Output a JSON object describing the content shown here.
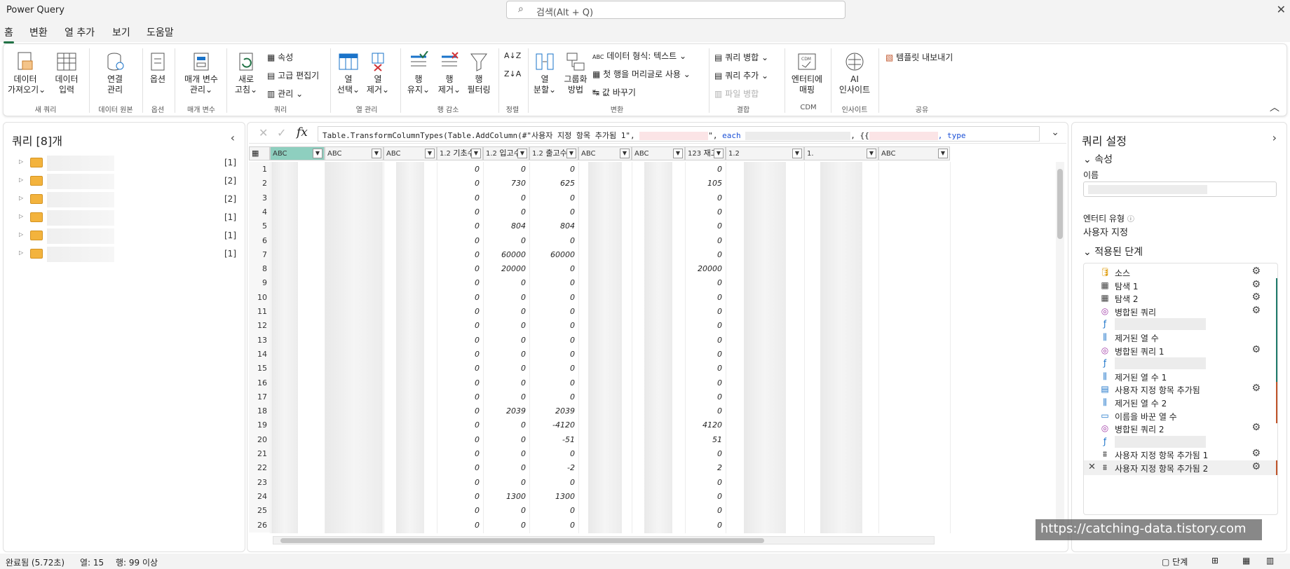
{
  "app": {
    "title": "Power Query"
  },
  "search": {
    "placeholder": "검색(Alt + Q)"
  },
  "tabs": [
    "홈",
    "변환",
    "열 추가",
    "보기",
    "도움말"
  ],
  "ribbon": {
    "get_data": "데이터\n가져오기⌄",
    "enter_data": "데이터\n입력",
    "group_new_query": "새 쿼리",
    "manage_connections": "연결\n관리",
    "group_data_source": "데이터 원본",
    "options": "옵션",
    "group_options": "옵션",
    "manage_params": "매개 변수\n관리⌄",
    "group_params": "매개 변수",
    "refresh": "새로\n고침⌄",
    "properties": "속성",
    "advanced_editor": "고급 편집기",
    "manage": "관리 ⌄",
    "group_query": "쿼리",
    "choose_columns": "열\n선택⌄",
    "remove_columns": "열\n제거⌄",
    "group_manage_columns": "열 관리",
    "keep_rows": "행\n유지⌄",
    "remove_rows": "행\n제거⌄",
    "filter_rows": "행\n필터링",
    "group_reduce_rows": "행 감소",
    "group_sort": "정렬",
    "split_column": "열\n분할⌄",
    "group_by": "그룹화\n방법",
    "data_type": "데이터 형식: 텍스트 ⌄",
    "first_row_header": "첫 행을 머리글로 사용 ⌄",
    "replace_values": "값 바꾸기",
    "group_transform": "변환",
    "merge_queries": "쿼리 병합 ⌄",
    "append_queries": "쿼리 추가 ⌄",
    "combine_files": "파일 병합",
    "group_combine": "결합",
    "map_entities": "엔터티에\n매핑",
    "group_cdm": "CDM",
    "ai_insights": "AI\n인사이트",
    "group_insights": "인사이트",
    "export_template": "템플릿 내보내기",
    "group_share": "공유"
  },
  "queries_panel": {
    "title": "쿼리 [8]개",
    "items": [
      {
        "count": "[1]"
      },
      {
        "count": "[2]"
      },
      {
        "count": "[2]"
      },
      {
        "count": "[1]"
      },
      {
        "count": "[1]"
      },
      {
        "count": "[1]"
      }
    ]
  },
  "formula": {
    "prefix": "Table.TransformColumnTypes(Table.AddColumn(#\"사용자 지정 항목 추가됨 1\",",
    "q1": "\",",
    "each": "each",
    "mid": ", {{",
    "type": ", type"
  },
  "columns": [
    {
      "type": "ABC",
      "label": ""
    },
    {
      "type": "ABC",
      "label": ""
    },
    {
      "type": "ABC",
      "label": ""
    },
    {
      "type": "1.2",
      "label": "기초수"
    },
    {
      "type": "1.2",
      "label": "입고수"
    },
    {
      "type": "1.2",
      "label": "출고수"
    },
    {
      "type": "ABC",
      "label": ""
    },
    {
      "type": "ABC",
      "label": ""
    },
    {
      "type": "123",
      "label": "재고"
    },
    {
      "type": "1.2",
      "label": ""
    },
    {
      "type": "1.",
      "label": ""
    },
    {
      "type": "ABC",
      "label": ""
    }
  ],
  "rows": [
    {
      "n": "1",
      "a": "0",
      "b": "0",
      "c": "0",
      "s": "0"
    },
    {
      "n": "2",
      "a": "0",
      "b": "730",
      "c": "625",
      "s": "105"
    },
    {
      "n": "3",
      "a": "0",
      "b": "0",
      "c": "0",
      "s": "0"
    },
    {
      "n": "4",
      "a": "0",
      "b": "0",
      "c": "0",
      "s": "0"
    },
    {
      "n": "5",
      "a": "0",
      "b": "804",
      "c": "804",
      "s": "0"
    },
    {
      "n": "6",
      "a": "0",
      "b": "0",
      "c": "0",
      "s": "0"
    },
    {
      "n": "7",
      "a": "0",
      "b": "60000",
      "c": "60000",
      "s": "0"
    },
    {
      "n": "8",
      "a": "0",
      "b": "20000",
      "c": "0",
      "s": "20000"
    },
    {
      "n": "9",
      "a": "0",
      "b": "0",
      "c": "0",
      "s": "0"
    },
    {
      "n": "10",
      "a": "0",
      "b": "0",
      "c": "0",
      "s": "0"
    },
    {
      "n": "11",
      "a": "0",
      "b": "0",
      "c": "0",
      "s": "0"
    },
    {
      "n": "12",
      "a": "0",
      "b": "0",
      "c": "0",
      "s": "0"
    },
    {
      "n": "13",
      "a": "0",
      "b": "0",
      "c": "0",
      "s": "0"
    },
    {
      "n": "14",
      "a": "0",
      "b": "0",
      "c": "0",
      "s": "0"
    },
    {
      "n": "15",
      "a": "0",
      "b": "0",
      "c": "0",
      "s": "0"
    },
    {
      "n": "16",
      "a": "0",
      "b": "0",
      "c": "0",
      "s": "0"
    },
    {
      "n": "17",
      "a": "0",
      "b": "0",
      "c": "0",
      "s": "0"
    },
    {
      "n": "18",
      "a": "0",
      "b": "2039",
      "c": "2039",
      "s": "0"
    },
    {
      "n": "19",
      "a": "0",
      "b": "0",
      "c": "-4120",
      "s": "4120"
    },
    {
      "n": "20",
      "a": "0",
      "b": "0",
      "c": "-51",
      "s": "51"
    },
    {
      "n": "21",
      "a": "0",
      "b": "0",
      "c": "0",
      "s": "0"
    },
    {
      "n": "22",
      "a": "0",
      "b": "0",
      "c": "-2",
      "s": "2"
    },
    {
      "n": "23",
      "a": "0",
      "b": "0",
      "c": "0",
      "s": "0"
    },
    {
      "n": "24",
      "a": "0",
      "b": "1300",
      "c": "1300",
      "s": "0"
    },
    {
      "n": "25",
      "a": "0",
      "b": "0",
      "c": "0",
      "s": "0"
    },
    {
      "n": "26",
      "a": "0",
      "b": "0",
      "c": "0",
      "s": "0"
    }
  ],
  "settings": {
    "title": "쿼리 설정",
    "properties": "속성",
    "name_label": "이름",
    "entity_type_label": "엔터티 유형",
    "entity_type_value": "사용자 지정",
    "applied_steps": "적용된 단계",
    "steps": [
      {
        "label": "소스",
        "icon": "database-icon",
        "gear": true,
        "rail": ""
      },
      {
        "label": "탐색 1",
        "icon": "table-icon",
        "gear": true,
        "rail": "#1f7a6b"
      },
      {
        "label": "탐색 2",
        "icon": "table-icon",
        "gear": true,
        "rail": "#1f7a6b"
      },
      {
        "label": "병합된 쿼리",
        "icon": "merge-icon",
        "gear": true,
        "rail": "#1f7a6b"
      },
      {
        "label": "",
        "icon": "function-icon",
        "gear": false,
        "rail": "#1f7a6b"
      },
      {
        "label": "제거된 열 수",
        "icon": "remove-columns-icon",
        "gear": false,
        "rail": "#1f7a6b"
      },
      {
        "label": "병합된 쿼리 1",
        "icon": "merge-icon",
        "gear": true,
        "rail": "#1f7a6b"
      },
      {
        "label": "",
        "icon": "function-icon",
        "gear": false,
        "rail": "#1f7a6b"
      },
      {
        "label": "제거된 열 수 1",
        "icon": "remove-columns-icon",
        "gear": false,
        "rail": "#1f7a6b"
      },
      {
        "label": "사용자 지정 항목 추가됨",
        "icon": "custom-column-icon",
        "gear": true,
        "rail": "#c0542a"
      },
      {
        "label": "제거된 열 수 2",
        "icon": "remove-columns-icon",
        "gear": false,
        "rail": "#c0542a"
      },
      {
        "label": "이름을 바꾼 열 수",
        "icon": "rename-icon",
        "gear": false,
        "rail": "#c0542a"
      },
      {
        "label": "병합된 쿼리 2",
        "icon": "merge-icon",
        "gear": true,
        "rail": ""
      },
      {
        "label": "",
        "icon": "function-icon",
        "gear": false,
        "rail": ""
      },
      {
        "label": "사용자 지정 항목 추가됨 1",
        "icon": "custom-step-icon",
        "gear": true,
        "rail": ""
      },
      {
        "label": "사용자 지정 항목 추가됨 2",
        "icon": "custom-step-icon",
        "gear": true,
        "rail": "#c0542a"
      }
    ]
  },
  "status": {
    "done": "완료됨 (5.72초)",
    "columns": "열: 15",
    "rows": "행: 99 이상",
    "steps_btn": "단계"
  },
  "watermark": "https://catching-data.tistory.com"
}
